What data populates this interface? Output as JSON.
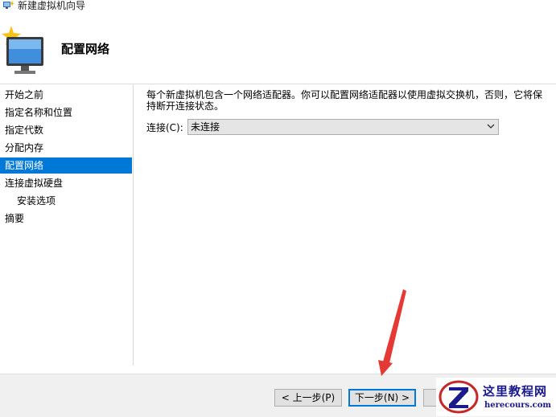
{
  "window": {
    "title": "新建虚拟机向导"
  },
  "header": {
    "title": "配置网络"
  },
  "nav": {
    "items": [
      {
        "label": "开始之前"
      },
      {
        "label": "指定名称和位置"
      },
      {
        "label": "指定代数"
      },
      {
        "label": "分配内存"
      },
      {
        "label": "配置网络"
      },
      {
        "label": "连接虚拟硬盘"
      },
      {
        "label": "安装选项"
      },
      {
        "label": "摘要"
      }
    ],
    "active": "配置网络"
  },
  "content": {
    "description": "每个新虚拟机包含一个网络适配器。你可以配置网络适配器以使用虚拟交换机，否则，它将保持断开连接状态。",
    "connection_label": "连接(C):",
    "connection_value": "未连接"
  },
  "footer": {
    "prev_label": "< 上一步(P)",
    "next_label": "下一步(N) >"
  },
  "watermark": {
    "title": "这里教程网",
    "url": "herecours.com"
  },
  "colors": {
    "accent": "#0078d7",
    "arrow": "#e53935"
  }
}
